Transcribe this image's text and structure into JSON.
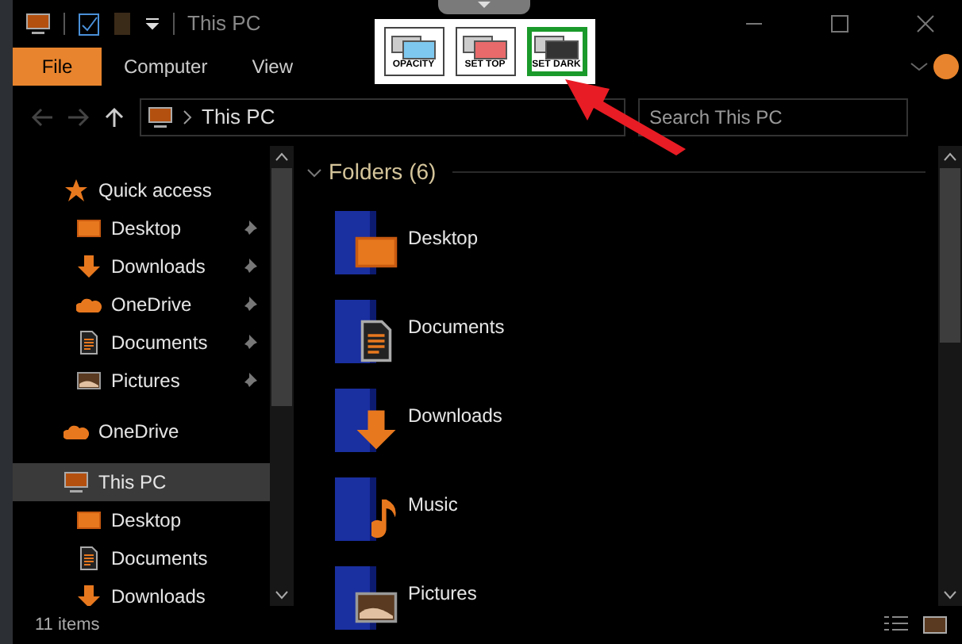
{
  "title_bar": {
    "title": "This PC"
  },
  "tool_panel": {
    "buttons": [
      {
        "label": "OPACITY",
        "kind": "opacity",
        "selected": false
      },
      {
        "label": "SET TOP",
        "kind": "top",
        "selected": false
      },
      {
        "label": "SET DARK",
        "kind": "dark",
        "selected": true
      }
    ]
  },
  "ribbon": {
    "tabs": [
      {
        "label": "File",
        "selected": true
      },
      {
        "label": "Computer",
        "selected": false
      },
      {
        "label": "View",
        "selected": false
      }
    ]
  },
  "address_bar": {
    "path": "This PC",
    "search": {
      "placeholder": "Search This PC"
    }
  },
  "navigation": [
    {
      "label": "Quick access",
      "kind": "star",
      "selected": false,
      "children": [
        {
          "label": "Desktop",
          "kind": "desktop",
          "pinned": true
        },
        {
          "label": "Downloads",
          "kind": "downloads",
          "pinned": true
        },
        {
          "label": "OneDrive",
          "kind": "onedrive",
          "pinned": true
        },
        {
          "label": "Documents",
          "kind": "documents",
          "pinned": true
        },
        {
          "label": "Pictures",
          "kind": "pictures",
          "pinned": true
        }
      ]
    },
    {
      "label": "OneDrive",
      "kind": "onedrive",
      "selected": false
    },
    {
      "label": "This PC",
      "kind": "pc",
      "selected": true,
      "children": [
        {
          "label": "Desktop",
          "kind": "desktop",
          "pinned": false
        },
        {
          "label": "Documents",
          "kind": "documents",
          "pinned": false
        },
        {
          "label": "Downloads",
          "kind": "downloads",
          "pinned": false
        }
      ]
    }
  ],
  "content": {
    "group": {
      "title": "Folders (6)",
      "expanded": true
    },
    "folders": [
      {
        "name": "Desktop",
        "kind": "desktop"
      },
      {
        "name": "Documents",
        "kind": "documents"
      },
      {
        "name": "Downloads",
        "kind": "downloads"
      },
      {
        "name": "Music",
        "kind": "music"
      },
      {
        "name": "Pictures",
        "kind": "pictures"
      }
    ]
  },
  "status_bar": {
    "text": "11 items"
  }
}
